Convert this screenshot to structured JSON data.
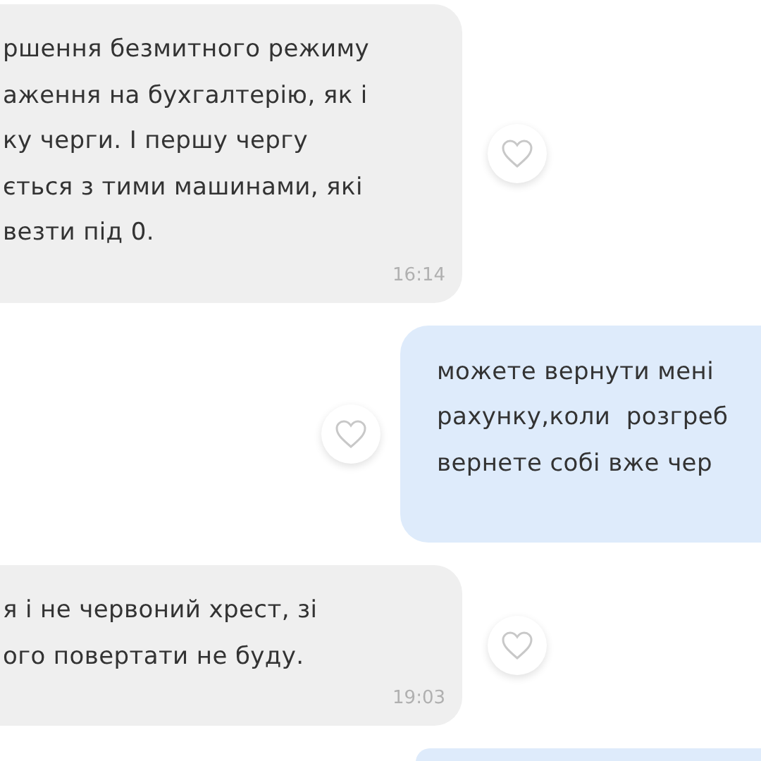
{
  "messages": [
    {
      "kind": "incoming",
      "lines": [
        "ршення безмитного режиму",
        "аження на бухгалтерію, як і",
        "ку черги. І першу чергу",
        "ється з тими машинами, які",
        "везти під 0."
      ],
      "time": "16:14"
    },
    {
      "kind": "outgoing",
      "lines": [
        "можете вернути мені",
        "рахунку,коли  розгреб",
        "вернете собі вже чер"
      ]
    },
    {
      "kind": "incoming",
      "lines": [
        "я і не червоний хрест, зі",
        "ого повертати не буду."
      ],
      "time": "19:03"
    },
    {
      "kind": "outgoing"
    }
  ]
}
